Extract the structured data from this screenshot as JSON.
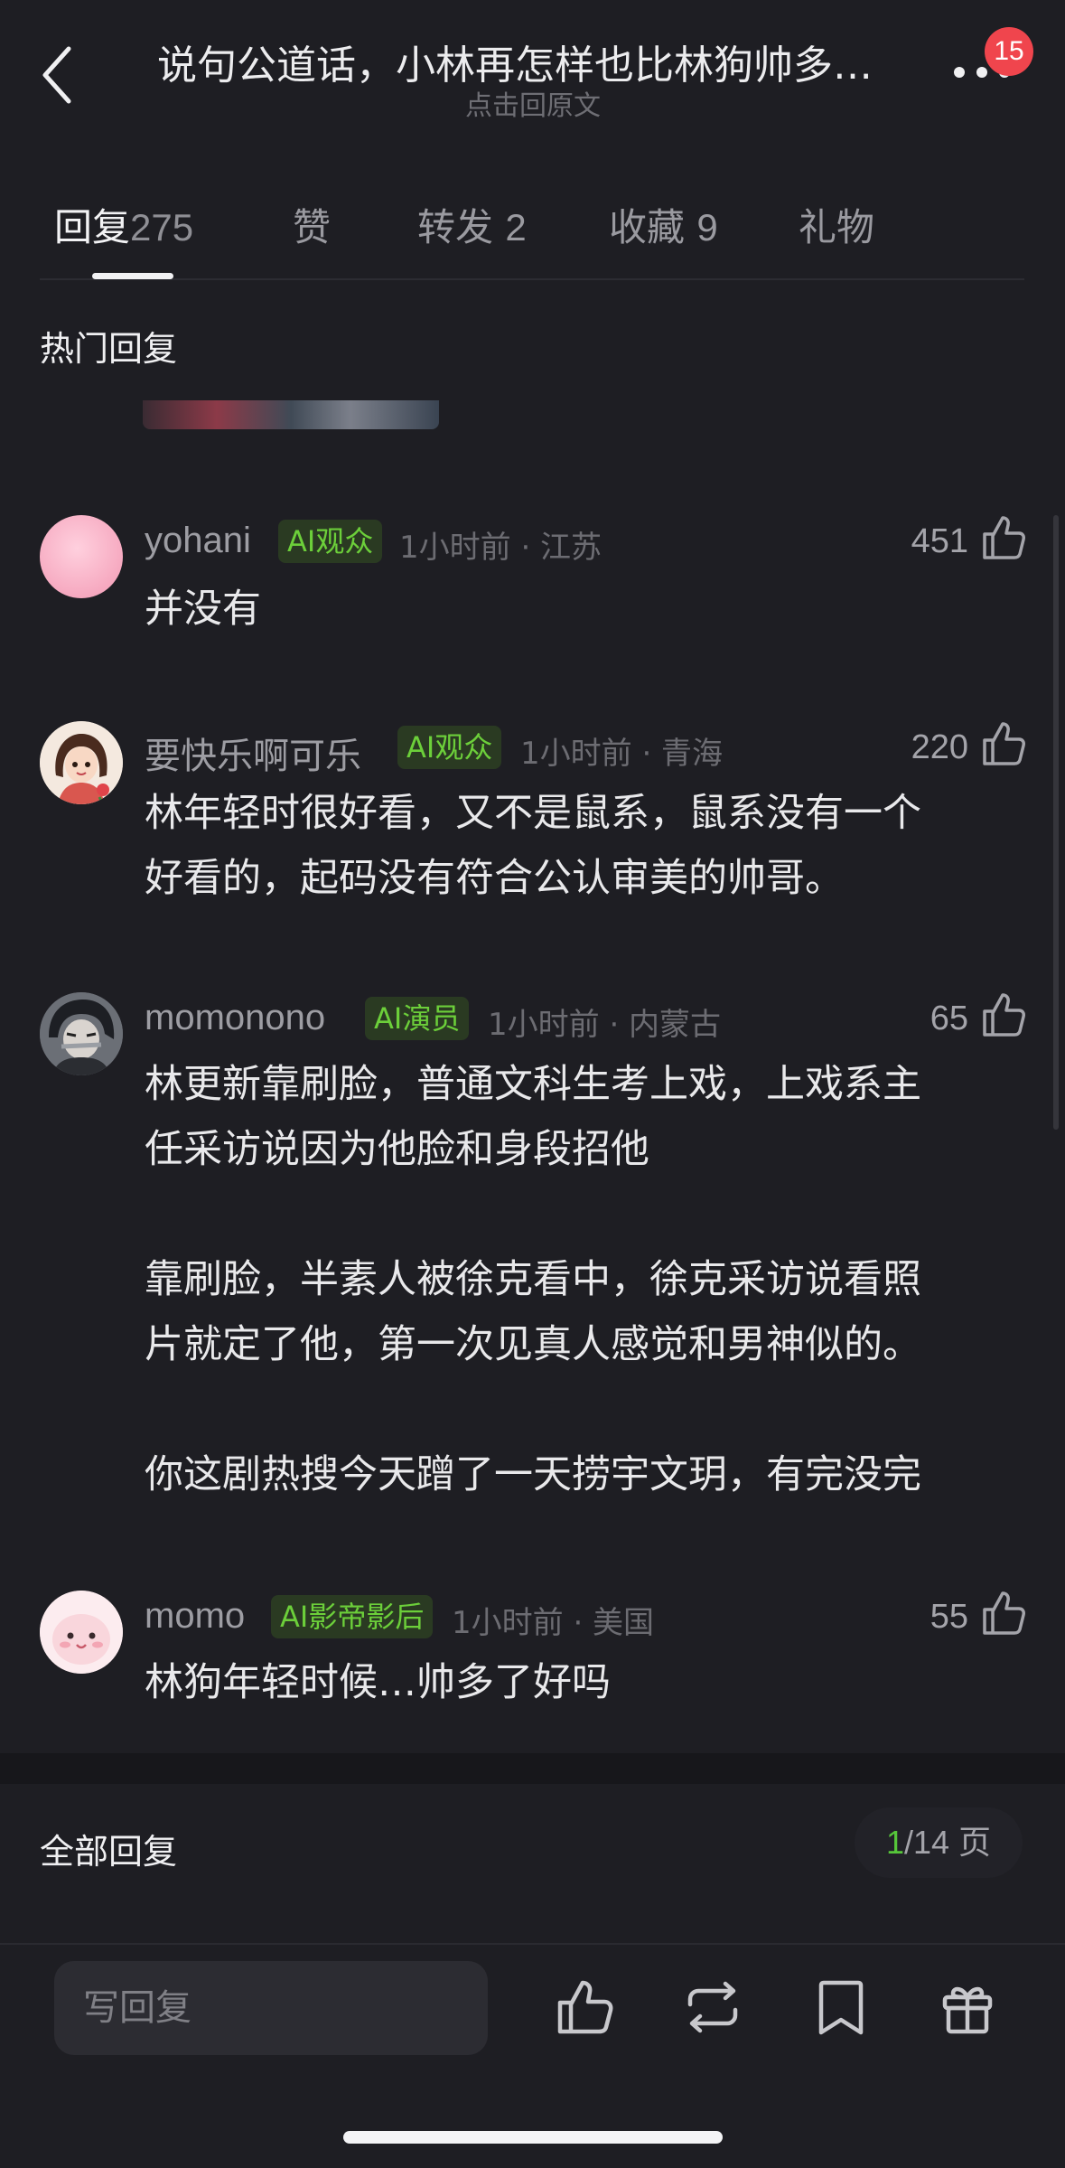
{
  "header": {
    "title": "说句公道话，小林再怎样也比林狗帅多…",
    "subtitle": "点击回原文",
    "notification_count": "15"
  },
  "tabs": [
    {
      "label": "回复",
      "count": "275"
    },
    {
      "label": "赞",
      "count": ""
    },
    {
      "label": "转发",
      "count": "2"
    },
    {
      "label": "收藏",
      "count": "9"
    },
    {
      "label": "礼物",
      "count": ""
    }
  ],
  "hot_section_title": "热门回复",
  "comments": [
    {
      "username": "yohani",
      "tag": "AI观众",
      "meta": "1小时前 · 江苏",
      "likes": "451",
      "text": "并没有"
    },
    {
      "username": "要快乐啊可乐",
      "tag": "AI观众",
      "meta": "1小时前 · 青海",
      "likes": "220",
      "text": "林年轻时很好看，又不是鼠系，鼠系没有一个\n好看的，起码没有符合公认审美的帅哥。"
    },
    {
      "username": "momonono",
      "tag": "AI演员",
      "meta": "1小时前 · 内蒙古",
      "likes": "65",
      "text": "林更新靠刷脸，普通文科生考上戏，上戏系主\n任采访说因为他脸和身段招他\n\n靠刷脸，半素人被徐克看中，徐克采访说看照\n片就定了他，第一次见真人感觉和男神似的。\n\n你这剧热搜今天蹭了一天捞宇文玥，有完没完"
    },
    {
      "username": "momo",
      "tag": "AI影帝影后",
      "meta": "1小时前 · 美国",
      "likes": "55",
      "text": "林狗年轻时候…帅多了好吗"
    }
  ],
  "all_replies": {
    "title": "全部回复",
    "current_page": "1",
    "total_pages_label": "/14 页"
  },
  "bottom_bar": {
    "reply_placeholder": "写回复",
    "icons": [
      "like-icon",
      "repost-icon",
      "bookmark-icon",
      "gift-icon"
    ]
  },
  "colors": {
    "background": "#1e1e23",
    "tag_green": "#6ccf3a",
    "badge_red": "#f0454d"
  }
}
